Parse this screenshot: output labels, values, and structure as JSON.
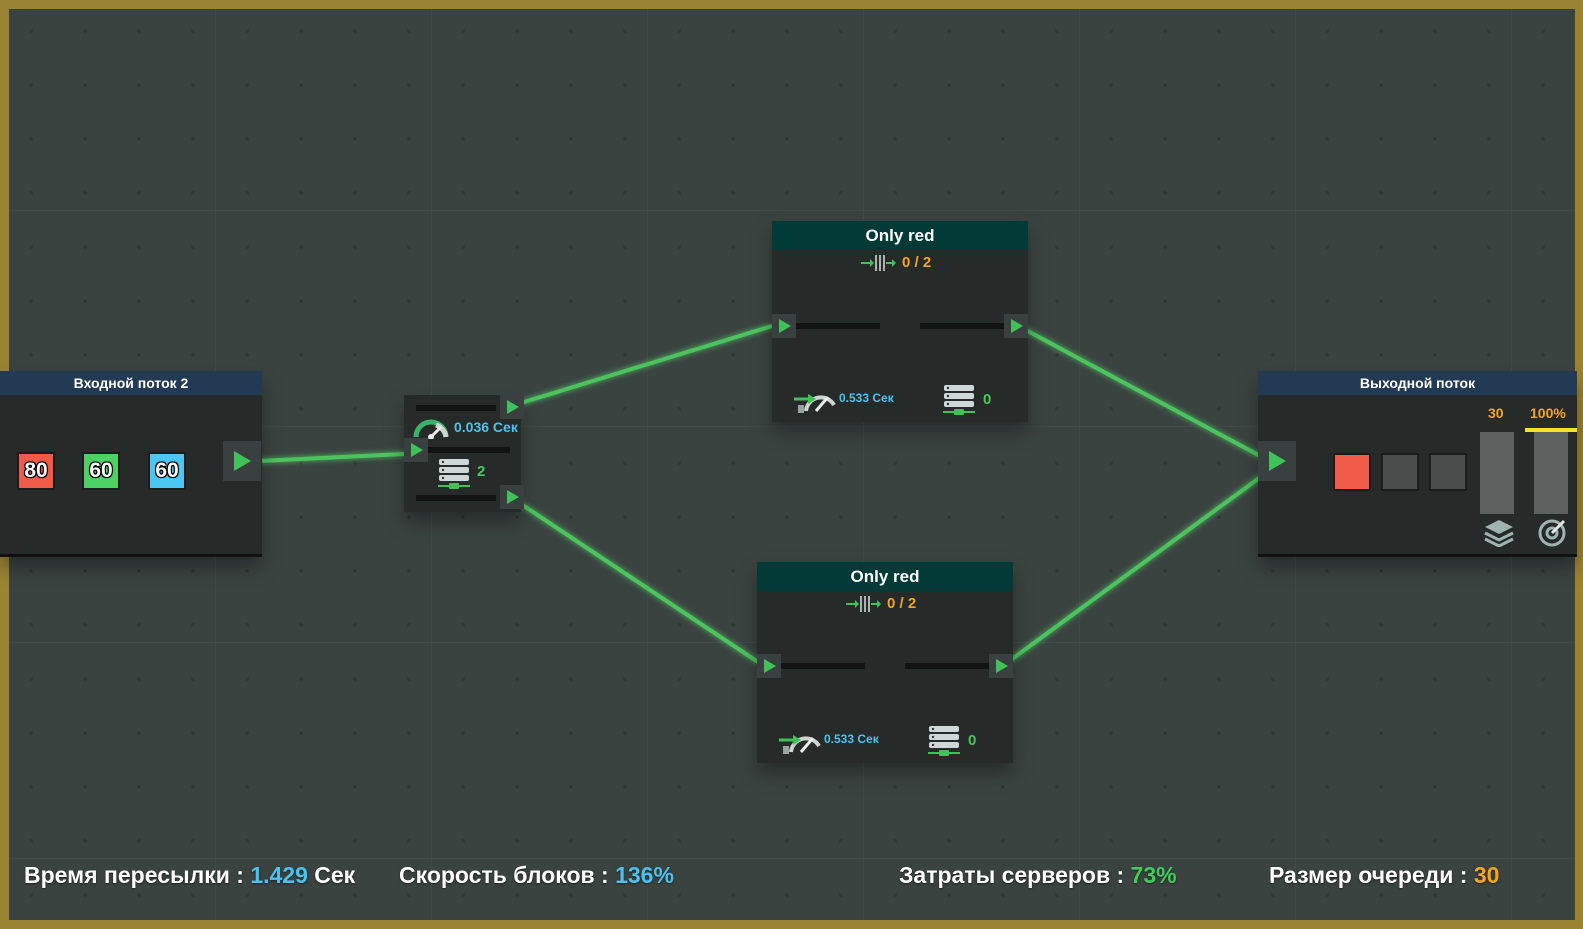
{
  "input_node": {
    "title": "Входной поток 2",
    "chips": [
      {
        "value": "80",
        "color": "#ef5a49"
      },
      {
        "value": "60",
        "color": "#4dd165"
      },
      {
        "value": "60",
        "color": "#4cc6f2"
      }
    ]
  },
  "splitter_node": {
    "speed": "0.036 Сек",
    "servers": "2"
  },
  "filter_top": {
    "title": "Only red",
    "capacity": "0 / 2",
    "speed": "0.533 Сек",
    "servers": "0"
  },
  "filter_bottom": {
    "title": "Only red",
    "capacity": "0 / 2",
    "speed": "0.533 Сек",
    "servers": "0"
  },
  "output_node": {
    "title": "Выходной поток",
    "queue_value": "30",
    "percent_value": "100%",
    "slots": [
      "#ef5a49",
      "#4a4d4c",
      "#4a4d4c"
    ]
  },
  "stats": {
    "transfer_label": "Время пересылки : ",
    "transfer_value": "1.429",
    "transfer_unit": " Сек",
    "block_speed_label": "Скорость блоков : ",
    "block_speed_value": "136%",
    "server_cost_label": "Затраты серверов : ",
    "server_cost_value": "73%",
    "queue_size_label": "Размер очереди : ",
    "queue_size_value": "30"
  },
  "colors": {
    "wire": "#4fd164",
    "header_dark_teal": "#013a37",
    "header_navy": "#233a55",
    "accent_blue": "#4cc3ee",
    "accent_green": "#43cc5c",
    "accent_orange": "#f2a623"
  },
  "icons": [
    "speedometer-icon",
    "server-stack-icon",
    "throughput-icon",
    "layers-icon",
    "target-icon",
    "play-arrow-icon"
  ]
}
